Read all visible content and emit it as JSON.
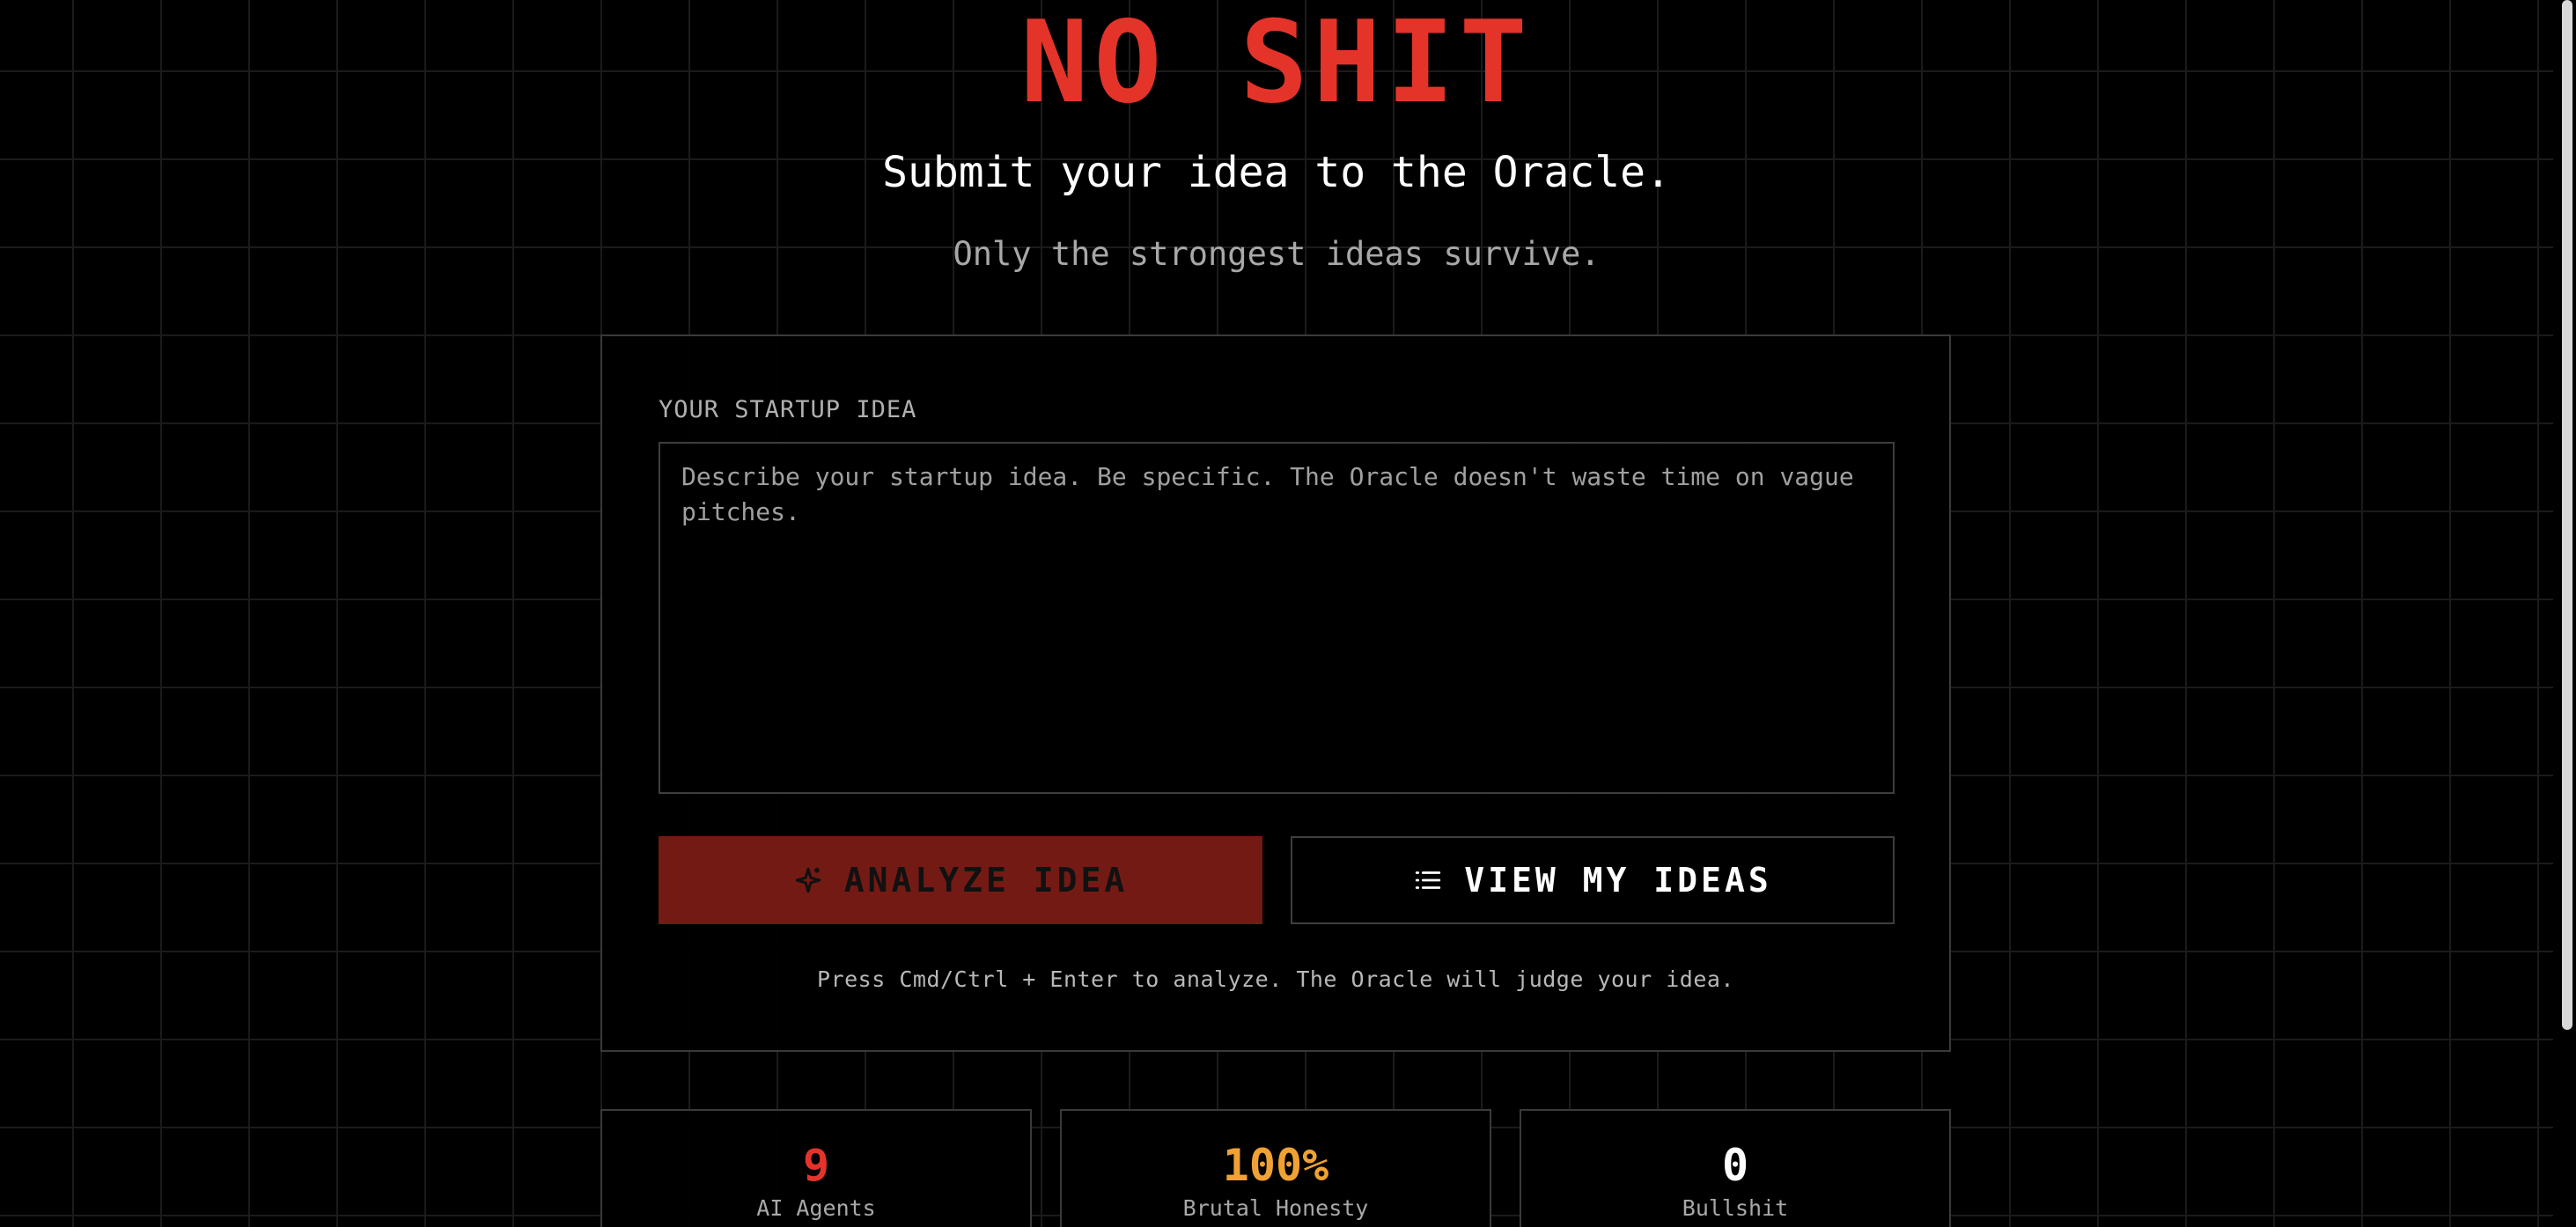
{
  "hero": {
    "title": "NO SHIT",
    "subtitle": "Submit your idea to the Oracle.",
    "tagline": "Only the strongest ideas survive."
  },
  "form": {
    "label": "YOUR STARTUP IDEA",
    "placeholder": "Describe your startup idea. Be specific. The Oracle doesn't waste time on vague pitches.",
    "analyze_label": "ANALYZE IDEA",
    "analyze_icon": "sparkle-icon",
    "view_label": "VIEW MY IDEAS",
    "view_icon": "list-icon",
    "hint": "Press Cmd/Ctrl + Enter to analyze. The Oracle will judge your idea."
  },
  "stats": [
    {
      "value": "9",
      "label": "AI Agents",
      "color": "#e4342a"
    },
    {
      "value": "100%",
      "label": "Brutal Honesty",
      "color": "#f0a133"
    },
    {
      "value": "0",
      "label": "Bullshit",
      "color": "#ffffff"
    }
  ],
  "colors": {
    "accent": "#e4342a",
    "analyze_bg": "#741a14",
    "highlight": "#f0a133",
    "background": "#000000"
  }
}
